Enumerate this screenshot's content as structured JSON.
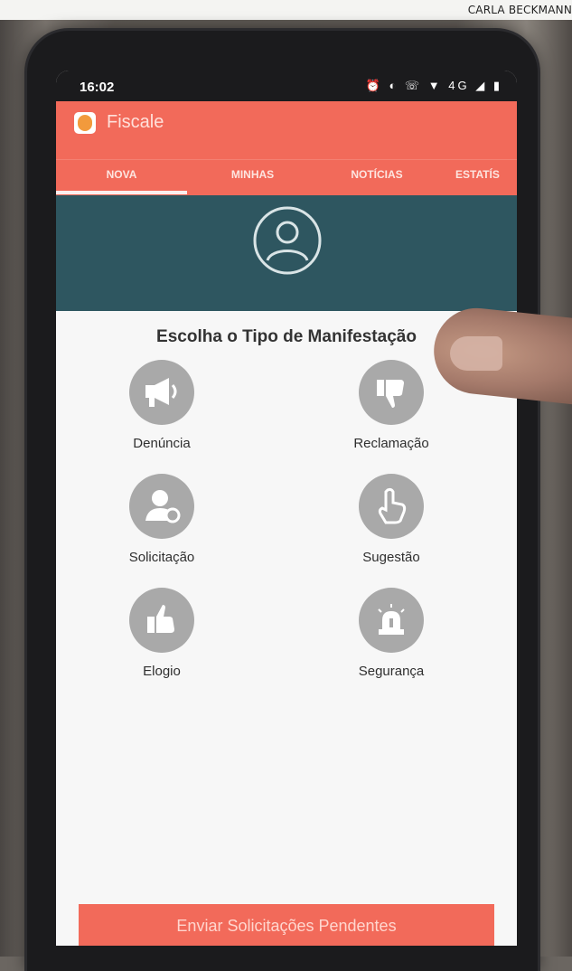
{
  "credit": "CARLA BECKMANN",
  "status": {
    "time": "16:02",
    "icons": "⏰ ◐ ☏ ▼ 4G ◢ ▮"
  },
  "app": {
    "title": "Fiscale"
  },
  "tabs": [
    "NOVA",
    "MINHAS",
    "NOTÍCIAS",
    "ESTATÍS"
  ],
  "content": {
    "title": "Escolha o Tipo de Manifestação",
    "options": [
      {
        "label": "Denúncia",
        "icon": "megaphone-icon"
      },
      {
        "label": "Reclamação",
        "icon": "thumbs-down-icon"
      },
      {
        "label": "Solicitação",
        "icon": "user-request-icon"
      },
      {
        "label": "Sugestão",
        "icon": "pointing-hand-icon"
      },
      {
        "label": "Elogio",
        "icon": "thumbs-up-icon"
      },
      {
        "label": "Segurança",
        "icon": "alarm-siren-icon"
      }
    ]
  },
  "bottom_button": "Enviar Solicitações Pendentes",
  "colors": {
    "primary": "#f26a5a",
    "header_band": "#2e5660",
    "icon_bg": "#a9a9a9"
  }
}
